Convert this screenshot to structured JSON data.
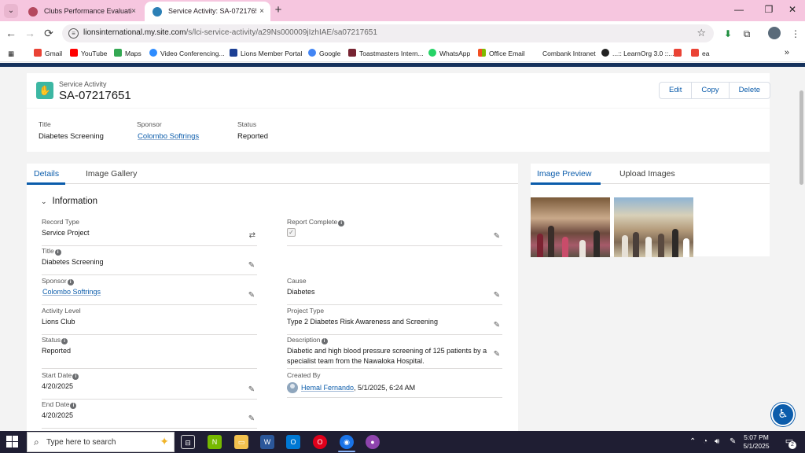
{
  "browser": {
    "tabs": [
      {
        "label": "Clubs Performance Evaluation S",
        "active": false
      },
      {
        "label": "Service Activity: SA-07217651",
        "active": true
      }
    ],
    "url_domain": "lionsinternational.my.site.com",
    "url_path": "/s/lci-service-activity/a29Ns000009jIzhIAE/sa07217651",
    "bookmarks": [
      "Gmail",
      "YouTube",
      "Maps",
      "Video Conferencing...",
      "Lions Member Portal",
      "Google",
      "Toastmasters Intern...",
      "WhatsApp",
      "Office Email",
      "Combank Intranet",
      "...:: LearnOrg 3.0 ::...",
      "",
      "ea"
    ],
    "icons": {
      "tab_close": "×",
      "new_tab": "+",
      "back": "←",
      "forward": "→",
      "reload": "⟳",
      "more_bookmarks": "»"
    }
  },
  "record": {
    "object_type": "Service Activity",
    "name": "SA-07217651",
    "buttons": {
      "edit": "Edit",
      "copy": "Copy",
      "delete": "Delete"
    },
    "highlights": {
      "title_label": "Title",
      "title_value": "Diabetes Screening",
      "sponsor_label": "Sponsor",
      "sponsor_value": "Colombo Softrings",
      "status_label": "Status",
      "status_value": "Reported"
    }
  },
  "details": {
    "tabs": {
      "details": "Details",
      "gallery": "Image Gallery"
    },
    "section_title": "Information",
    "left": {
      "record_type": {
        "label": "Record Type",
        "value": "Service Project"
      },
      "title": {
        "label": "Title",
        "value": "Diabetes Screening"
      },
      "sponsor": {
        "label": "Sponsor",
        "value": "Colombo Softrings"
      },
      "activity_level": {
        "label": "Activity Level",
        "value": "Lions Club"
      },
      "status": {
        "label": "Status",
        "value": "Reported"
      },
      "start_date": {
        "label": "Start Date",
        "value": "4/20/2025"
      },
      "end_date": {
        "label": "End Date",
        "value": "4/20/2025"
      }
    },
    "right": {
      "report_complete": {
        "label": "Report Complete",
        "checked": true
      },
      "cause": {
        "label": "Cause",
        "value": "Diabetes"
      },
      "project_type": {
        "label": "Project Type",
        "value": "Type 2 Diabetes Risk Awareness and Screening"
      },
      "description": {
        "label": "Description",
        "value": "Diabetic and high blood pressure screening of 125 patients by a specialist team from the Nawaloka Hospital."
      },
      "created_by": {
        "label": "Created By",
        "user": "Hemal Fernando",
        "date": ", 5/1/2025, 6:24 AM"
      }
    }
  },
  "images": {
    "tabs": {
      "preview": "Image Preview",
      "upload": "Upload Images"
    }
  },
  "taskbar": {
    "search_placeholder": "Type here to search",
    "time": "5:07 PM",
    "date": "5/1/2025",
    "notification_count": "2"
  },
  "colors": {
    "brand_blue": "#0b5cab",
    "sf_header": "#16325c",
    "object_icon": "#3cb7a3",
    "tab_bar": "#f6c6df"
  }
}
